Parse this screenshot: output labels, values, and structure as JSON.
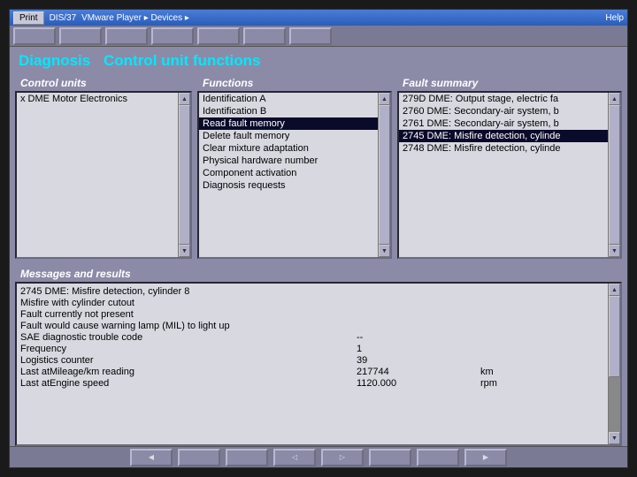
{
  "titlebar": {
    "print": "Print",
    "app": "DIS/37",
    "vmware": "VMware Player ▸ Devices ▸",
    "help": "Help"
  },
  "breadcrumb": {
    "a": "Diagnosis",
    "b": "Control unit functions"
  },
  "panels": {
    "control_units": {
      "header": "Control units",
      "items": [
        {
          "label": "x DME Motor Electronics",
          "selected": false
        }
      ]
    },
    "functions": {
      "header": "Functions",
      "items": [
        {
          "label": "Identification A",
          "selected": false
        },
        {
          "label": "Identification B",
          "selected": false
        },
        {
          "label": "Read fault memory",
          "selected": true
        },
        {
          "label": "Delete fault memory",
          "selected": false
        },
        {
          "label": "Clear mixture adaptation",
          "selected": false
        },
        {
          "label": "Physical hardware number",
          "selected": false
        },
        {
          "label": "Component activation",
          "selected": false
        },
        {
          "label": "Diagnosis requests",
          "selected": false
        }
      ]
    },
    "fault_summary": {
      "header": "Fault summary",
      "items": [
        {
          "label": "279D DME: Output stage, electric fa",
          "selected": false
        },
        {
          "label": "2760 DME: Secondary-air system, b",
          "selected": false
        },
        {
          "label": "2761 DME: Secondary-air system, b",
          "selected": false
        },
        {
          "label": "2745 DME: Misfire detection, cylinde",
          "selected": true
        },
        {
          "label": "2748 DME: Misfire detection, cylinde",
          "selected": false
        }
      ]
    }
  },
  "results": {
    "header": "Messages and results",
    "lines": [
      {
        "label": "2745 DME: Misfire detection, cylinder 8",
        "val": "",
        "unit": ""
      },
      {
        "label": "Misfire with cylinder cutout",
        "val": "",
        "unit": ""
      },
      {
        "label": "Fault currently not present",
        "val": "",
        "unit": ""
      },
      {
        "label": "Fault would cause warning lamp (MIL) to light up",
        "val": "",
        "unit": ""
      },
      {
        "label": "SAE diagnostic trouble code",
        "val": "--",
        "unit": ""
      },
      {
        "label": "Frequency",
        "val": "1",
        "unit": ""
      },
      {
        "label": "Logistics counter",
        "val": "39",
        "unit": ""
      },
      {
        "label": "Last atMileage/km reading",
        "val": "217744",
        "unit": "km"
      },
      {
        "label": "Last atEngine speed",
        "val": "1120.000",
        "unit": "rpm"
      }
    ]
  },
  "nav": {
    "left": "◀",
    "prev": "◁",
    "next": "▷",
    "right": "▶"
  }
}
